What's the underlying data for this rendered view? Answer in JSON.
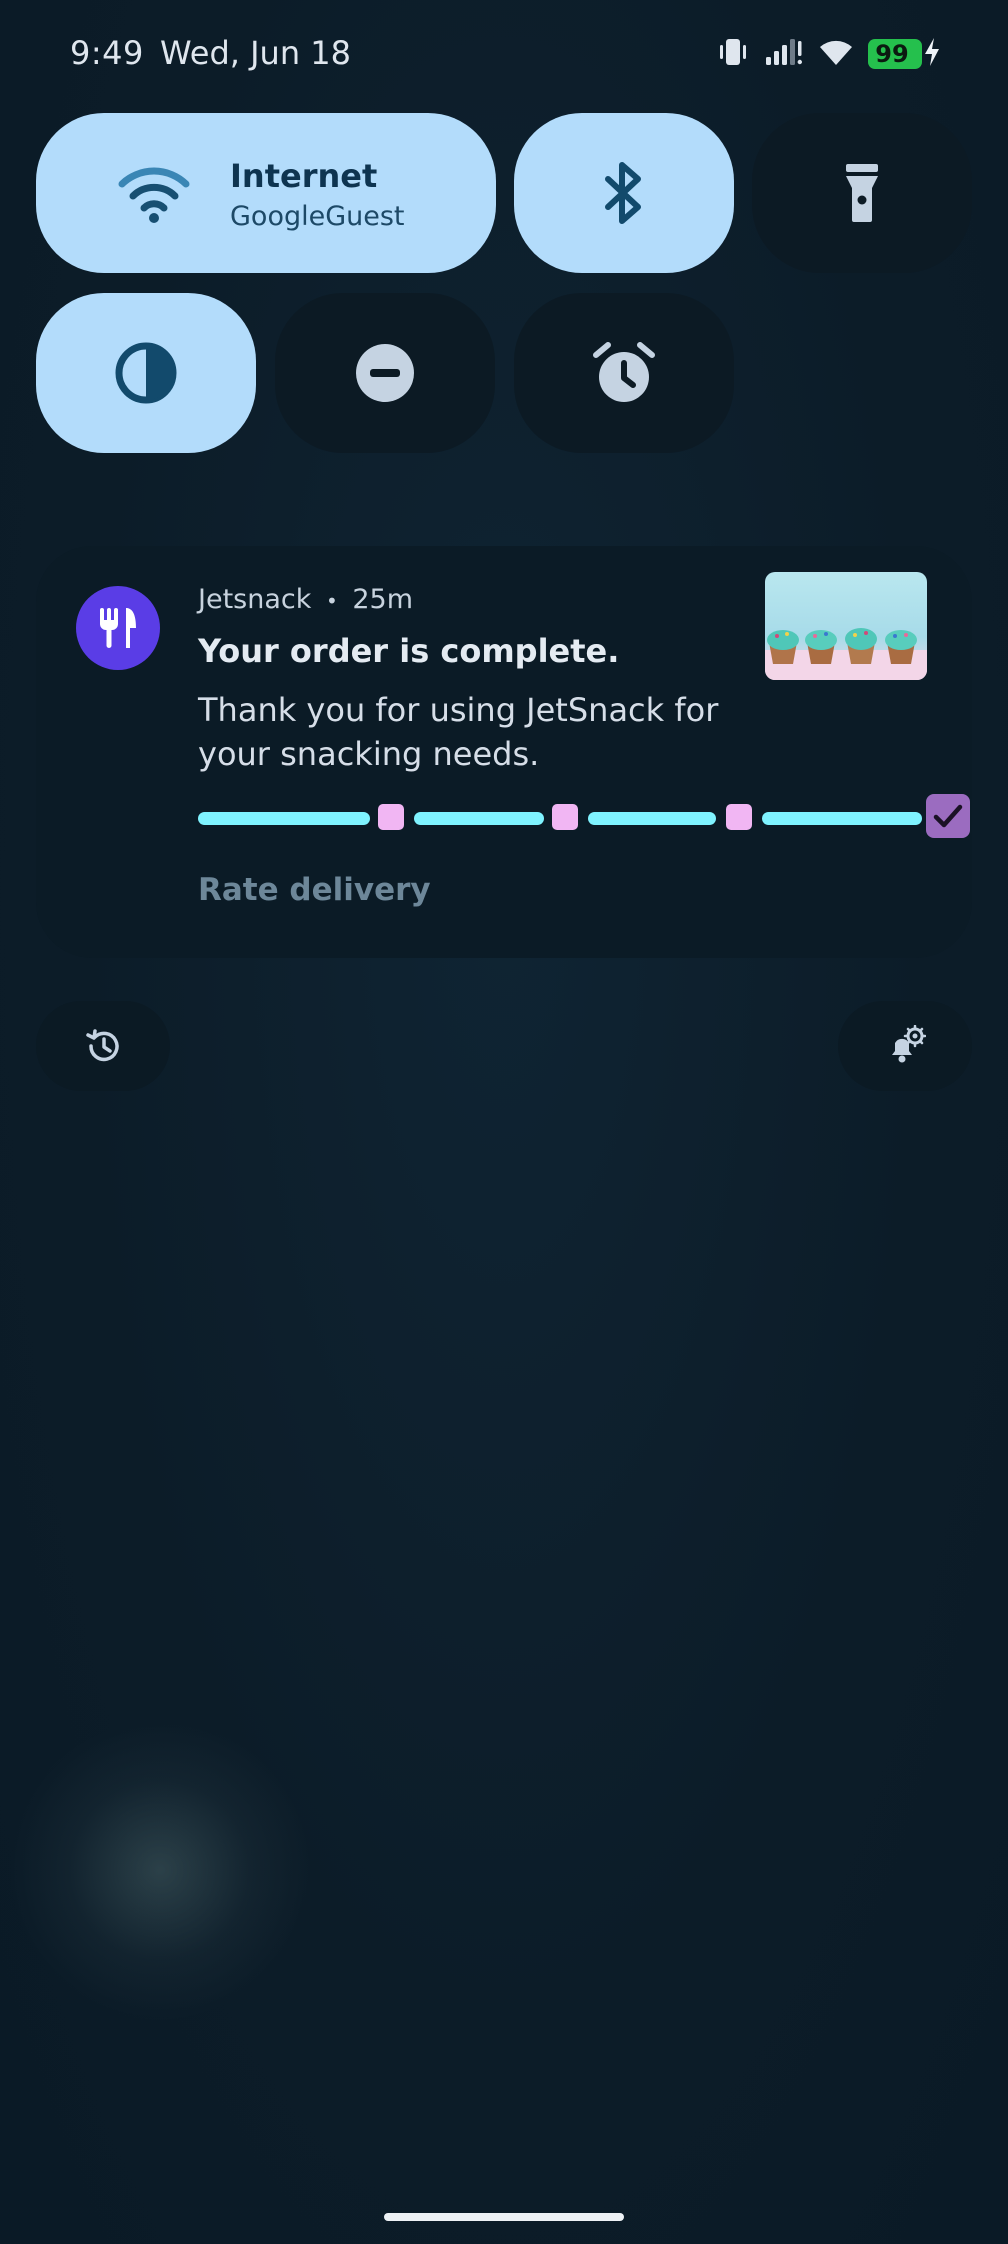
{
  "status_bar": {
    "time": "9:49",
    "date": "Wed, Jun 18",
    "battery_level": "99",
    "icons": [
      "vibrate-icon",
      "cell-signal-icon",
      "wifi-icon",
      "battery-icon",
      "charging-bolt-icon"
    ]
  },
  "quick_settings": {
    "internet": {
      "title": "Internet",
      "subtitle": "GoogleGuest",
      "icon": "wifi-icon",
      "state": "on"
    },
    "bluetooth": {
      "icon": "bluetooth-icon",
      "state": "on"
    },
    "flashlight": {
      "icon": "flashlight-icon",
      "state": "off"
    },
    "contrast": {
      "icon": "contrast-icon",
      "state": "on"
    },
    "do_not_disturb": {
      "icon": "do-not-disturb-icon",
      "state": "off"
    },
    "alarm": {
      "icon": "alarm-icon",
      "state": "off"
    }
  },
  "notification": {
    "app_name": "Jetsnack",
    "separator": "•",
    "time_ago": "25m",
    "title": "Your order is complete.",
    "body": "Thank you for using JetSnack for your snacking needs.",
    "progress_fraction": 1.0,
    "progress_milestones": 4,
    "action_label": "Rate delivery",
    "colors": {
      "app_icon_bg": "#5a3de6",
      "progress_track": "#7ff3ff",
      "milestone": "#f1b6f3",
      "final_milestone": "#9b6cc0"
    }
  },
  "footer": {
    "history_icon": "history-icon",
    "notification_settings_icon": "notification-settings-icon"
  }
}
